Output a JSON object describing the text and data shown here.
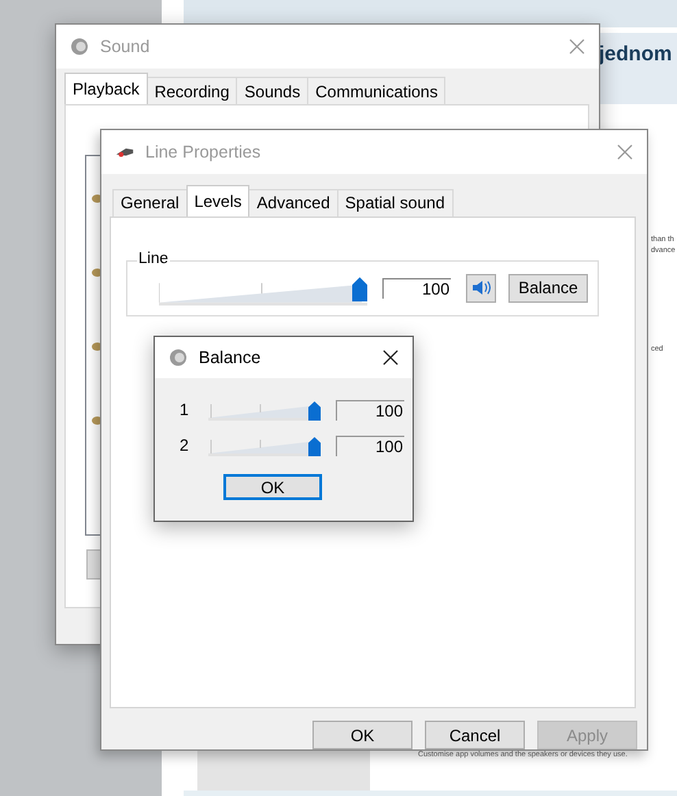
{
  "background": {
    "heading": "jednom",
    "fragments": [
      "than th",
      "dvance",
      "ced"
    ],
    "caption": "Customise app volumes and the speakers or devices they use."
  },
  "sound_window": {
    "title": "Sound",
    "tabs": [
      {
        "label": "Playback",
        "selected": true
      },
      {
        "label": "Recording",
        "selected": false
      },
      {
        "label": "Sounds",
        "selected": false
      },
      {
        "label": "Communications",
        "selected": false
      }
    ]
  },
  "line_properties": {
    "title": "Line Properties",
    "tabs": [
      {
        "label": "General",
        "selected": false
      },
      {
        "label": "Levels",
        "selected": true
      },
      {
        "label": "Advanced",
        "selected": false
      },
      {
        "label": "Spatial sound",
        "selected": false
      }
    ],
    "group_label": "Line",
    "level": 1,
    "value": "100",
    "muted": false,
    "balance_button": "Balance",
    "buttons": [
      {
        "label": "OK",
        "disabled": false
      },
      {
        "label": "Cancel",
        "disabled": false
      },
      {
        "label": "Apply",
        "disabled": true
      }
    ]
  },
  "balance_dialog": {
    "title": "Balance",
    "channels": [
      {
        "label": "1",
        "level": 1,
        "value": "100"
      },
      {
        "label": "2",
        "level": 1,
        "value": "100"
      }
    ],
    "ok": "OK"
  }
}
